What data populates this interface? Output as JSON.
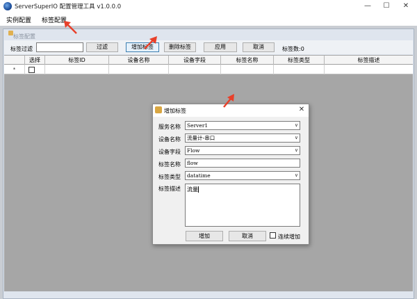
{
  "window": {
    "title": "ServerSuperIO 配置管理工具 v1.0.0.0"
  },
  "menu": {
    "items": [
      "实例配置",
      "标签配置"
    ]
  },
  "child_window": {
    "title": "标签配置"
  },
  "toolbar": {
    "filter_label": "标签过滤",
    "filter_value": "",
    "filter_button": "过滤",
    "add_button": "增加标签",
    "delete_button": "删除标签",
    "apply_button": "应用",
    "cancel_button": "取消",
    "count_text": "标签数:0"
  },
  "grid": {
    "columns": [
      "",
      "选择",
      "标签ID",
      "设备名称",
      "设备字段",
      "标签名称",
      "标签类型",
      "标签描述"
    ],
    "rows": [
      {
        "marker": "*",
        "checked": false
      }
    ]
  },
  "dialog": {
    "title": "增加标签",
    "fields": [
      {
        "label": "服务名称",
        "value": "Server1",
        "type": "combo"
      },
      {
        "label": "设备名称",
        "value": "流量计-串口",
        "type": "combo"
      },
      {
        "label": "设备字段",
        "value": "Flow",
        "type": "combo"
      },
      {
        "label": "标签名称",
        "value": "flow",
        "type": "text"
      },
      {
        "label": "标签类型",
        "value": "datatime",
        "type": "combo"
      }
    ],
    "description_label": "标签描述",
    "description_value": "流量",
    "add_button": "增加",
    "cancel_button": "取消",
    "continuous_label": "连续增加",
    "continuous_checked": false
  },
  "colors": {
    "annotation_arrow": "#e8402a",
    "mdi_background": "#a6a6a6",
    "focus_border": "#3c7fb1"
  }
}
